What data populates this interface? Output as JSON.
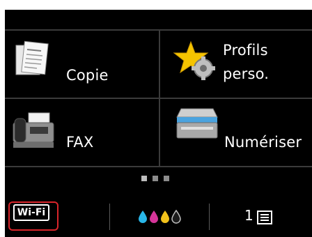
{
  "home": {
    "tiles": [
      {
        "label": "Copie",
        "icon": "copy-document-icon"
      },
      {
        "label_line1": "Profils",
        "label_line2": "perso.",
        "icon": "custom-profile-star-gear-icon"
      },
      {
        "label": "FAX",
        "icon": "fax-machine-icon"
      },
      {
        "label": "Numériser",
        "icon": "scanner-icon"
      }
    ],
    "page_indicator": {
      "pages": 3,
      "current": 1
    }
  },
  "status_bar": {
    "wifi_label": "Wi-Fi",
    "ink_colors": [
      "#29b6e8",
      "#d6359a",
      "#f2c21b",
      "#1b1b1b"
    ],
    "paper_tray_label": "1"
  },
  "colors": {
    "highlight_frame": "#d9252b",
    "background": "#000000"
  }
}
